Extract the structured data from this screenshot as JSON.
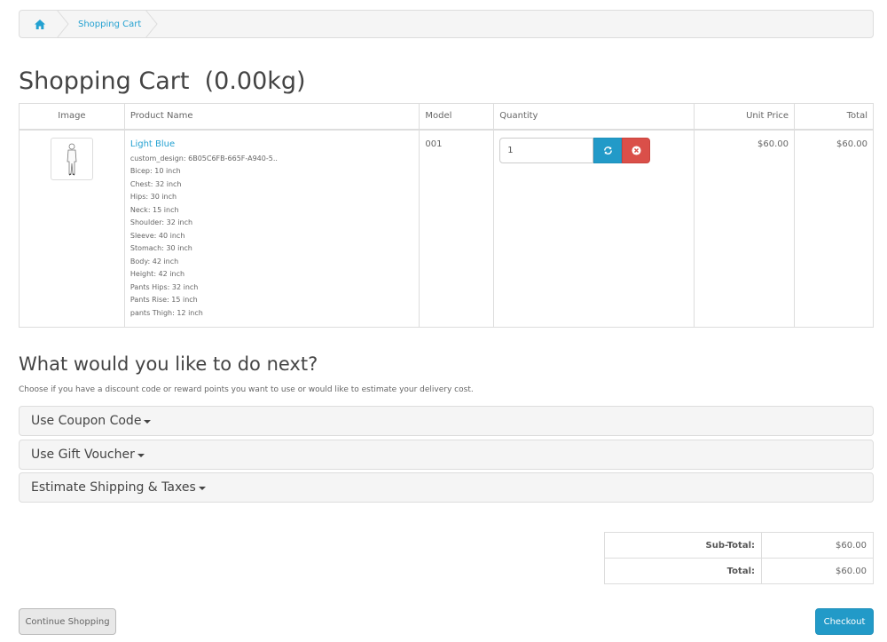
{
  "breadcrumb": {
    "home_icon": "home-icon",
    "items": [
      "Shopping Cart"
    ]
  },
  "page_title": "Shopping Cart  (0.00kg)",
  "cart_table": {
    "headers": {
      "image": "Image",
      "product_name": "Product Name",
      "model": "Model",
      "quantity": "Quantity",
      "unit_price": "Unit Price",
      "total": "Total"
    },
    "rows": [
      {
        "image": "product-thumbnail",
        "name": "Light Blue",
        "options": [
          "custom_design: 6B05C6FB-665F-A940-5..",
          "Bicep: 10 inch",
          "Chest: 32 inch",
          "Hips: 30 inch",
          "Neck: 15 inch",
          "Shoulder: 32 inch",
          "Sleeve: 40 inch",
          "Stomach: 30 inch",
          "Body: 42 inch",
          "Height: 42 inch",
          "Pants Hips: 32 inch",
          "Pants Rise: 15 inch",
          "pants Thigh: 12 inch"
        ],
        "model": "001",
        "quantity": "1",
        "unit_price": "$60.00",
        "total": "$60.00"
      }
    ]
  },
  "next": {
    "title": "What would you like to do next?",
    "description": "Choose if you have a discount code or reward points you want to use or would like to estimate your delivery cost.",
    "panels": [
      "Use Coupon Code",
      "Use Gift Voucher",
      "Estimate Shipping & Taxes"
    ]
  },
  "totals": [
    {
      "label": "Sub-Total:",
      "value": "$60.00"
    },
    {
      "label": "Total:",
      "value": "$60.00"
    }
  ],
  "buttons": {
    "continue": "Continue Shopping",
    "checkout": "Checkout"
  },
  "colors": {
    "link": "#23a1d1",
    "primary": "#229ac8",
    "danger": "#da4f49"
  }
}
